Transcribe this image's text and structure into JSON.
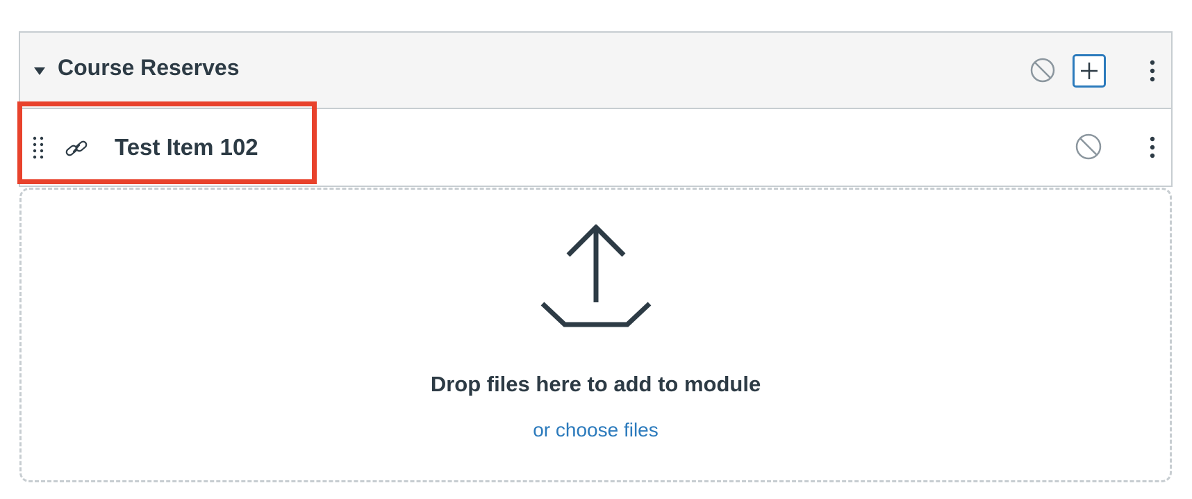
{
  "module": {
    "title": "Course Reserves",
    "header_icons": [
      "caret-down-icon",
      "unpublished-icon",
      "add-icon",
      "kebab-menu-icon"
    ]
  },
  "items": [
    {
      "title": "Test Item 102",
      "type_icon": "link-icon",
      "status_icon": "unpublished-icon"
    }
  ],
  "dropzone": {
    "message": "Drop files here to add to module",
    "choose_label": "or choose files",
    "icon": "upload-icon"
  },
  "colors": {
    "highlight": "#e8422c",
    "link": "#2b7abc",
    "text": "#2d3b45",
    "header_bg": "#f5f5f5",
    "border": "#c7cdd1"
  }
}
